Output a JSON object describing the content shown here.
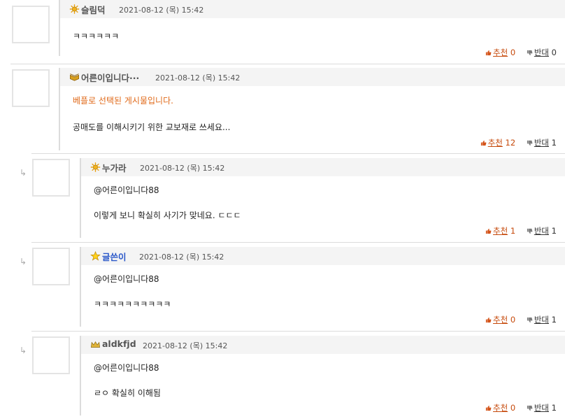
{
  "ui": {
    "reply_arrow": "↳",
    "recommend_label": "추천",
    "oppose_label": "반대"
  },
  "colors": {
    "recommend": "#c64a0c",
    "nick_blue": "#2b58c9",
    "best_notice": "#e06a1a"
  },
  "comments": [
    {
      "nick": "슬림덕",
      "level_icon": "sun-badge-icon",
      "date": "2021-08-12 (목) 15:42",
      "lines": [
        "ㅋㅋㅋㅋㅋㅋ"
      ],
      "recommend": "0",
      "oppose": "0"
    },
    {
      "nick": "어른이입니다···",
      "level_icon": "book-badge-icon",
      "date": "2021-08-12 (목) 15:42",
      "notice": "베플로 선택된 게시물입니다.",
      "lines": [
        "공매도를 이해시키기 위한 교보재로 쓰세요..."
      ],
      "recommend": "12",
      "oppose": "1"
    },
    {
      "nick": "누가라",
      "level_icon": "sun-badge-icon",
      "date": "2021-08-12 (목) 15:42",
      "lines": [
        "@어른이입니다88",
        "이렇게 보니 확실히 사기가 맞네요. ㄷㄷㄷ"
      ],
      "recommend": "1",
      "oppose": "1"
    },
    {
      "nick": "글쓴이",
      "level_icon": "star-badge-icon",
      "date": "2021-08-12 (목) 15:42",
      "lines": [
        "@어른이입니다88",
        "ㅋㅋㅋㅋㅋㅋㅋㅋㅋㅋ"
      ],
      "recommend": "0",
      "oppose": "1"
    },
    {
      "nick": "aldkfjd",
      "level_icon": "crown-badge-icon",
      "date": "2021-08-12 (목) 15:42",
      "lines": [
        "@어른이입니다88",
        "ㄹㅇ 확실히 이해됨"
      ],
      "recommend": "0",
      "oppose": "1"
    }
  ]
}
